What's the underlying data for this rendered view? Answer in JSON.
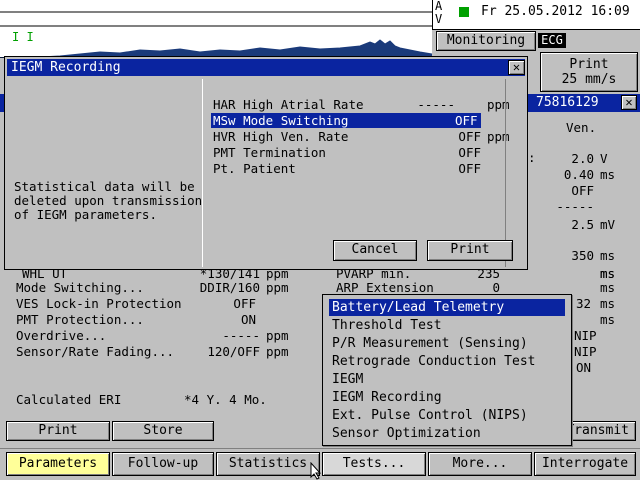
{
  "header": {
    "marker_a": "A",
    "marker_v": "V",
    "datetime": "Fr 25.05.2012 16:09",
    "monitoring_label": "Monitoring",
    "ecg_label": "ECG",
    "print_speed_label_1": "Print",
    "print_speed_label_2": "25 mm/s",
    "serial": "75816129",
    "ecg_marker": "I I"
  },
  "dialog": {
    "title": "IEGM Recording",
    "message_1": "Statistical data will be",
    "message_2": "deleted upon transmission",
    "message_3": "of IEGM parameters.",
    "items": [
      {
        "label": "HAR High Atrial Rate",
        "value": "-----",
        "unit": "ppm",
        "selected": false
      },
      {
        "label": "MSw Mode Switching",
        "value": "OFF",
        "unit": "",
        "selected": true
      },
      {
        "label": "HVR High Ven. Rate",
        "value": "OFF",
        "unit": "ppm",
        "selected": false
      },
      {
        "label": "PMT Termination",
        "value": "OFF",
        "unit": "",
        "selected": false
      },
      {
        "label": "Pt. Patient",
        "value": "OFF",
        "unit": "",
        "selected": false
      }
    ],
    "cancel_label": "Cancel",
    "print_label": "Print"
  },
  "right_panel": {
    "ven_header": "Ven.",
    "rows": [
      {
        "value": "2.0",
        "unit": "V"
      },
      {
        "value": "0.40",
        "unit": "ms"
      },
      {
        "value": "OFF",
        "unit": ""
      },
      {
        "value": "-----",
        "unit": ""
      },
      {
        "value": "2.5",
        "unit": "mV"
      },
      {
        "value": "350",
        "unit": "ms"
      }
    ],
    "side_values": {
      "v_32": "32",
      "v_ms": "ms",
      "nip1": "NIP",
      "nip2": "NIP",
      "on": "ON",
      "v_ms2": "ms"
    },
    "transmit_label": "Transmit"
  },
  "params": {
    "rows": [
      {
        "label": "WHL UT",
        "value": "*130/141",
        "unit": "ppm"
      },
      {
        "label": "Mode Switching...",
        "value": "DDIR/160",
        "unit": "ppm"
      },
      {
        "label": "VES Lock-in Protection",
        "value": "OFF",
        "unit": ""
      },
      {
        "label": "PMT Protection...",
        "value": "ON",
        "unit": ""
      },
      {
        "label": "Overdrive...",
        "value": "-----",
        "unit": "ppm"
      },
      {
        "label": "Sensor/Rate Fading...",
        "value": "120/OFF",
        "unit": "ppm"
      }
    ],
    "mid_rows": [
      {
        "label": "PVARP min.",
        "value": "235",
        "unit": "ms"
      },
      {
        "label": "ARP Extension",
        "value": "0",
        "unit": "ms"
      }
    ],
    "eri_label": "Calculated ERI",
    "eri_value": "*4 Y. 4 Mo.",
    "print_label": "Print",
    "store_label": "Store"
  },
  "tests_menu": {
    "items": [
      {
        "label": "Battery/Lead Telemetry",
        "selected": true
      },
      {
        "label": "Threshold Test",
        "selected": false
      },
      {
        "label": "P/R Measurement (Sensing)",
        "selected": false
      },
      {
        "label": "Retrograde Conduction Test",
        "selected": false
      },
      {
        "label": "IEGM",
        "selected": false
      },
      {
        "label": "IEGM Recording",
        "selected": false
      },
      {
        "label": "Ext. Pulse Control (NIPS)",
        "selected": false
      },
      {
        "label": "Sensor Optimization",
        "selected": false
      }
    ]
  },
  "bottom_tabs": {
    "parameters": "Parameters",
    "follow_up": "Follow-up",
    "statistics": "Statistics",
    "tests": "Tests...",
    "more": "More...",
    "interrogate": "Interrogate"
  },
  "colors": {
    "selection": "#0a24a0",
    "active_tab": "#ffff99",
    "status_green": "#00a000"
  }
}
